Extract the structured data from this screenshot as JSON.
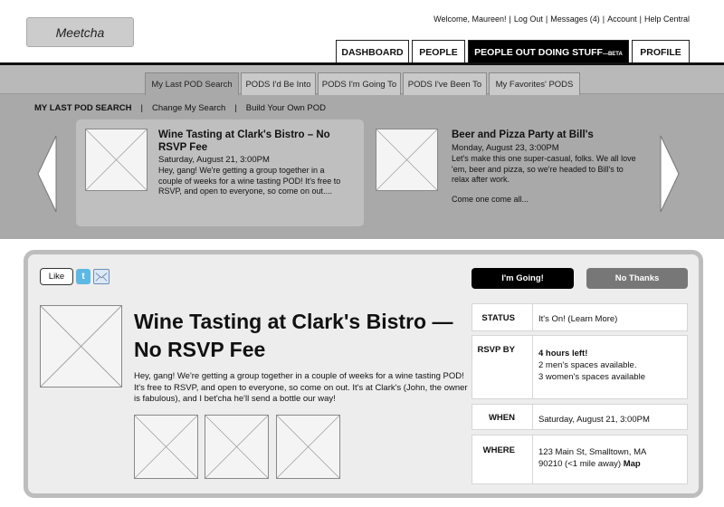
{
  "app": {
    "logo": "Meetcha"
  },
  "header": {
    "welcome": "Welcome, Maureen!",
    "links": [
      "Log Out",
      "Messages (4)",
      "Account",
      "Help Central"
    ]
  },
  "main_tabs": [
    {
      "label": "Dashboard",
      "active": false
    },
    {
      "label": "People",
      "active": false
    },
    {
      "label": "People Out Doing Stuff",
      "suffix": "—BETA",
      "active": true
    },
    {
      "label": "Profile",
      "active": false
    }
  ],
  "sub_tabs": [
    {
      "label": "My Last POD Search",
      "active": true
    },
    {
      "label": "PODS I'd Be Into",
      "active": false
    },
    {
      "label": "PODS I'm Going To",
      "active": false
    },
    {
      "label": "PODS I've Been To",
      "active": false
    },
    {
      "label": "My Favorites' PODS",
      "active": false
    }
  ],
  "sub_nav": {
    "current": "MY LAST POD SEARCH",
    "links": [
      "Change My Search",
      "Build Your Own POD"
    ]
  },
  "results": [
    {
      "title": "Wine Tasting at Clark's Bistro – No RSVP Fee",
      "date": "Saturday, August 21, 3:00PM",
      "description": "Hey, gang! We're getting a group together in a couple of weeks for a wine tasting POD! It's free to RSVP, and open to everyone, so come on out....",
      "selected": true
    },
    {
      "title": "Beer and Pizza Party at Bill's",
      "date": "Monday, August 23, 3:00PM",
      "description": "Let's make this one super-casual, folks. We all love 'em, beer and pizza, so we're headed to Bill's to relax after work.",
      "extra": "Come one come all...",
      "selected": false
    }
  ],
  "detail": {
    "like": "Like",
    "going_button": "I'm Going!",
    "no_thanks_button": "No Thanks",
    "title": "Wine Tasting at Clark's Bistro — No RSVP Fee",
    "description": "Hey, gang! We're getting a group together in a couple of weeks for a wine tasting POD! It's free to RSVP, and open to everyone, so come on out. It's at Clark's (John, the owner is fabulous), and I bet'cha he'll send a bottle our way!",
    "info": {
      "status_label": "STATUS",
      "status_value": "It's On! (Learn More)",
      "rsvp_label": "RSVP BY",
      "rsvp_line1": "4 hours left!",
      "rsvp_line2": "2 men's spaces available.",
      "rsvp_line3": "3 women's spaces available",
      "when_label": "WHEN",
      "when_value": "Saturday, August 21, 3:00PM",
      "where_label": "WHERE",
      "where_line1": "123 Main St, Smalltown, MA",
      "where_line2": "90210 (<1 mile away)",
      "map_link": "Map"
    }
  },
  "colors": {
    "tab_active_bg": "#000000",
    "search_band": "#a9a9a9",
    "selected_card": "#bfbfbf",
    "no_thanks_bg": "#777777",
    "twitter_blue": "#5db8e3"
  }
}
